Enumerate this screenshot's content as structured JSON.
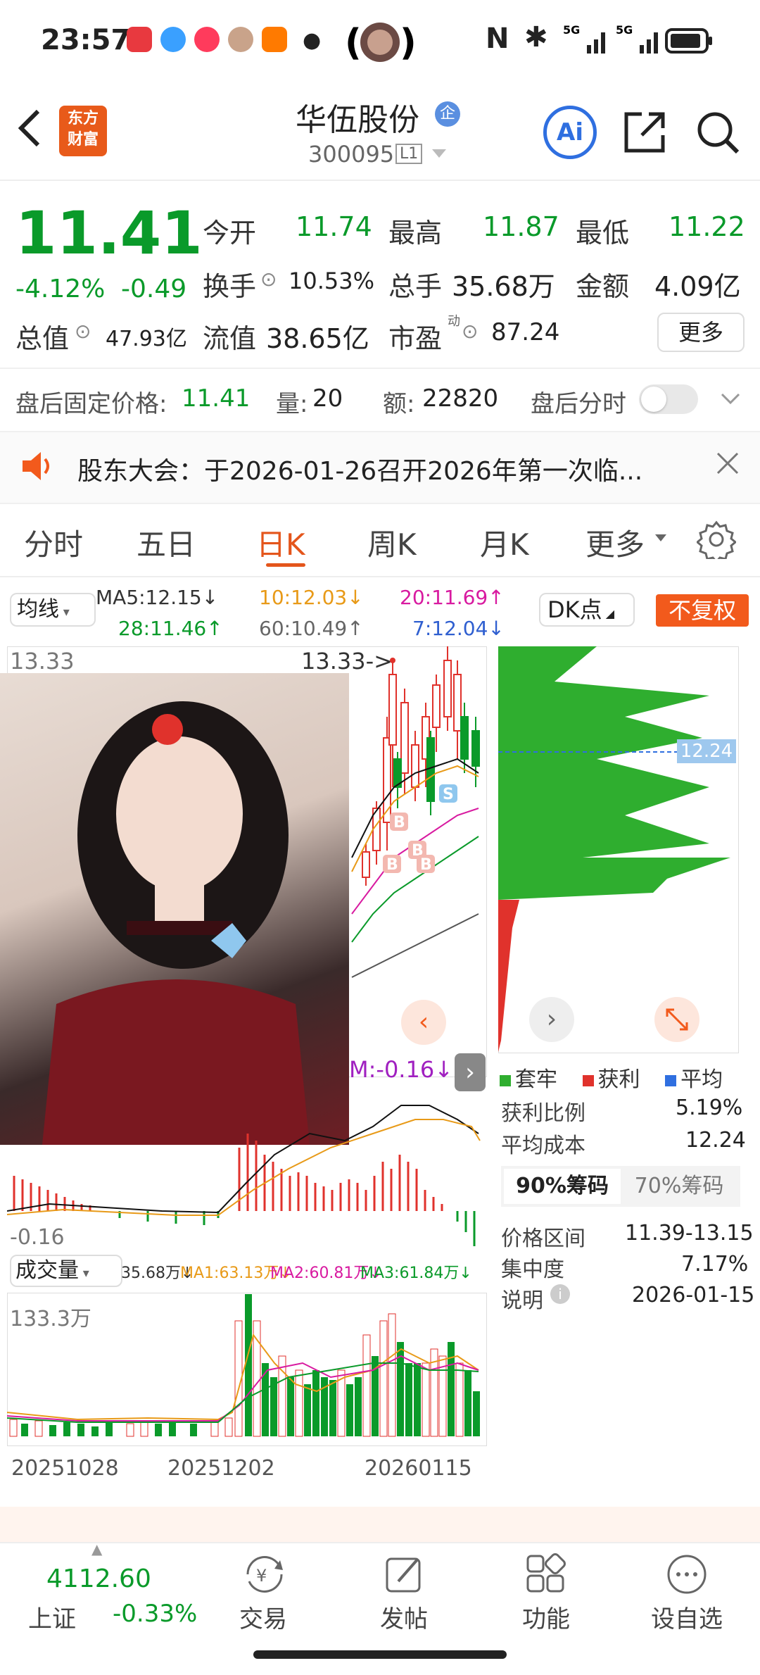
{
  "status_bar": {
    "time": "23:57",
    "nfc": "N",
    "bluetooth": "bluetooth-icon",
    "net1": "5G",
    "net2": "5G",
    "app_icons": [
      "#e8393f",
      "#3aa0ff",
      "#ff3b5c",
      "#ff7a00"
    ]
  },
  "header": {
    "logo_line1": "东方",
    "logo_line2": "财富",
    "stock_name": "华伍股份",
    "badge": "企",
    "stock_code": "300095",
    "level": "L1",
    "ai_label": "Ai"
  },
  "quote": {
    "price": "11.41",
    "change_pct": "-4.12%",
    "change": "-0.49",
    "open_label": "今开",
    "open": "11.74",
    "high_label": "最高",
    "high": "11.87",
    "low_label": "最低",
    "low": "11.22",
    "turnover_label": "换手",
    "turnover": "10.53%",
    "volume_label": "总手",
    "volume": "35.68万",
    "amount_label": "金额",
    "amount": "4.09亿",
    "mktcap_label": "总值",
    "mktcap": "47.93亿",
    "float_label": "流值",
    "float": "38.65亿",
    "pe_label": "市盈",
    "pe_sup": "动",
    "pe": "87.24",
    "more_label": "更多"
  },
  "after_hours": {
    "label": "盘后固定价格:",
    "price": "11.41",
    "vol_label": "量:",
    "vol": "20",
    "amt_label": "额:",
    "amt": "22820",
    "toggle_label": "盘后分时"
  },
  "notice": {
    "text": "股东大会：于2026-01-26召开2026年第一次临..."
  },
  "tabs": [
    "分时",
    "五日",
    "日K",
    "周K",
    "月K",
    "更多"
  ],
  "active_tab": 2,
  "ma_bar": {
    "selector": "均线",
    "ma5": "MA5:12.15↓",
    "ma10": "10:12.03↓",
    "ma20": "20:11.69↑",
    "ma28": "28:11.46↑",
    "ma60": "60:10.49↑",
    "ma7": "7:12.04↓",
    "dk_label": "DK点",
    "fq_label": "不复权"
  },
  "kline": {
    "top_label": "13.33",
    "top_marker": "13.33->",
    "macd_label": "M:-0.16↓",
    "macd_low": "-0.16",
    "buy_marker": "B",
    "sell_marker": "S"
  },
  "chip": {
    "avg_price_tag": "12.24",
    "legend": [
      {
        "label": "套牢",
        "color": "#2fae2f"
      },
      {
        "label": "获利",
        "color": "#e0322c"
      },
      {
        "label": "平均",
        "color": "#2f6fe0"
      }
    ],
    "profit_ratio_label": "获利比例",
    "profit_ratio": "5.19%",
    "avg_cost_label": "平均成本",
    "avg_cost": "12.24",
    "tab90": "90%筹码",
    "tab70": "70%筹码",
    "range_label": "价格区间",
    "range": "11.39-13.15",
    "concentration_label": "集中度",
    "concentration": "7.17%",
    "note_label": "说明",
    "note_date": "2026-01-15"
  },
  "volume_bar": {
    "selector": "成交量",
    "vol": "35.68万↓",
    "ma1": "MA1:63.13万↓",
    "ma2": "MA2:60.81万↓",
    "ma3": "MA3:61.84万↓",
    "top_label": "133.3万"
  },
  "dates": [
    "20251028",
    "20251202",
    "20260115"
  ],
  "bottom_nav": {
    "index_value": "4112.60",
    "index_name": "上证",
    "index_change": "-0.33%",
    "items": [
      {
        "label": "交易",
        "icon": "trade-icon"
      },
      {
        "label": "发帖",
        "icon": "edit-icon"
      },
      {
        "label": "功能",
        "icon": "grid-icon"
      },
      {
        "label": "设自选",
        "icon": "more-icon"
      }
    ]
  }
}
